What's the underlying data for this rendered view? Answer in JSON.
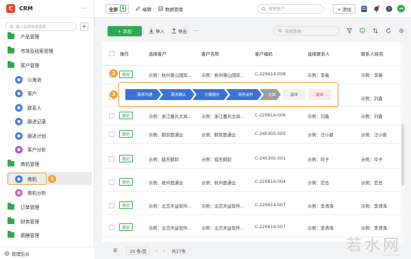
{
  "app": {
    "title": "CRM",
    "logo_glyph": "C",
    "more": "···"
  },
  "sidebar": {
    "search_placeholder": "输入名称快速搜索",
    "add": "+",
    "items": [
      {
        "label": "产品管理",
        "icon": "folder-icon"
      },
      {
        "label": "市场及线索管理",
        "icon": "folder-icon"
      },
      {
        "label": "客户管理",
        "icon": "folder-icon"
      },
      {
        "label": "公海池",
        "icon": "user-circle-icon"
      },
      {
        "label": "客户",
        "icon": "user-circle-icon"
      },
      {
        "label": "联系人",
        "icon": "user-circle-icon"
      },
      {
        "label": "跟进记录",
        "icon": "user-circle-icon"
      },
      {
        "label": "跟进计划",
        "icon": "user-circle-icon"
      },
      {
        "label": "客户分析",
        "icon": "chart-circle-icon"
      },
      {
        "label": "商机管理",
        "icon": "folder-icon"
      },
      {
        "label": "商机",
        "icon": "opportunity-circle-icon"
      },
      {
        "label": "商机分析",
        "icon": "chart-circle-icon"
      },
      {
        "label": "订单管理",
        "icon": "folder-icon"
      },
      {
        "label": "财务管理",
        "icon": "folder-icon"
      },
      {
        "label": "薪酬管理",
        "icon": "folder-icon"
      }
    ],
    "bottom": "管理后台",
    "callout_1": "1"
  },
  "topbar": {
    "all": "全部",
    "edit": "编辑",
    "data_manage": "数据管理",
    "search_placeholder": "搜索客户",
    "add": "+ 添加"
  },
  "toolbar": {
    "add": "+ 添加",
    "import": "导入",
    "export": "导出",
    "search_placeholder": "搜索数据"
  },
  "table": {
    "headers": [
      "操作",
      "选择客户",
      "客户名称",
      "客户编码",
      "选择联系人",
      "联系人姓名"
    ],
    "follow_label": "跟进",
    "rows": [
      [
        "示例：杭州萧山国际...",
        "示例：杭州萧山国际...",
        "C-220614-008",
        "示例：李薇",
        "示例：李薇"
      ],
      [
        "",
        "",
        "",
        "",
        "示例：刘鑫"
      ],
      [
        "示例：浙江嘉光文具...",
        "示例：浙江嘉光文具...",
        "C-220614-006",
        "示例：刘鑫",
        "示例：刘鑫"
      ],
      [
        "示例：鹤软面通云",
        "示例：鹤软面通云",
        "C-240305-005",
        "示例：汪小姐",
        "示例：汪小姐"
      ],
      [
        "示例：猎东鹤软",
        "示例：猎东鹤软",
        "C-240305-001",
        "示例：玲子",
        "示例：玲子"
      ],
      [
        "示例：杭州面通云",
        "示例：杭州面通云",
        "C-220614-004",
        "示例：范总",
        "示例：范总"
      ],
      [
        "示例：北京天益软件...",
        "示例：北京天益软件...",
        "C-220614-007",
        "示例：李清海",
        "示例：李清海"
      ],
      [
        "示例：北京天益软件...",
        "示例：北京天益软件...",
        "C-220614-007",
        "示例：李清海",
        "示例：李清海"
      ]
    ]
  },
  "stages": {
    "items": [
      "需求沟通",
      "需求确认",
      "方案报价",
      "商务谈判",
      "无效",
      "赢单",
      "输单"
    ],
    "callout_2": "2",
    "callout_3": "3"
  },
  "footer": {
    "page_size": "20 条/页",
    "prev": "‹",
    "next": "›",
    "total": "共27条"
  },
  "watermark": {
    "text": "若水网",
    "sub": "ruoshui.com"
  },
  "colors": {
    "accent": "#2fa84f",
    "stage_blue": "#3a73d8",
    "highlight": "#f0a33a",
    "danger": "#e14b4b"
  }
}
